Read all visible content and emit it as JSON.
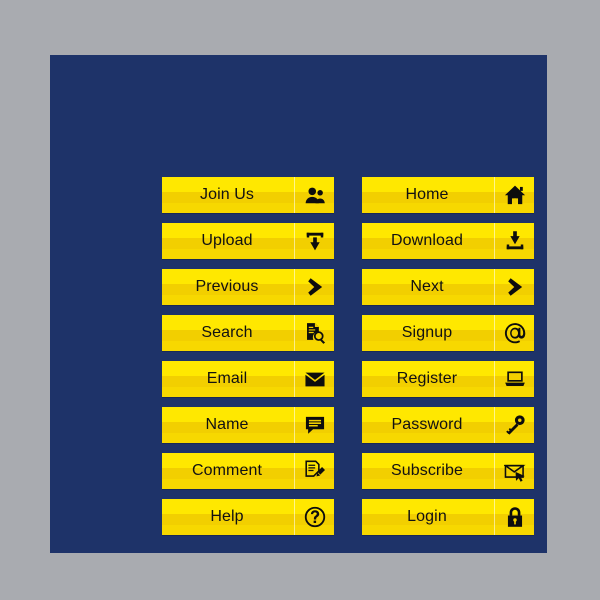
{
  "canvas": {
    "background_color": "#a9abb0",
    "panel_color": "#1e3369"
  },
  "theme": {
    "button_yellow_top": "#ffe800",
    "button_yellow_mid": "#f2cf00",
    "button_yellow_bottom": "#f7d800",
    "label_color": "#111111",
    "icon_color": "#0d0d0d"
  },
  "buttons": {
    "left_column": [
      {
        "label": "Join Us",
        "icon": "users-icon"
      },
      {
        "label": "Upload",
        "icon": "upload-tray-icon"
      },
      {
        "label": "Previous",
        "icon": "chevron-right-icon"
      },
      {
        "label": "Search",
        "icon": "document-magnifier-icon"
      },
      {
        "label": "Email",
        "icon": "envelope-icon"
      },
      {
        "label": "Name",
        "icon": "speech-bubble-icon"
      },
      {
        "label": "Comment",
        "icon": "document-pencil-icon"
      },
      {
        "label": "Help",
        "icon": "question-mark-circle-icon"
      }
    ],
    "right_column": [
      {
        "label": "Home",
        "icon": "house-icon"
      },
      {
        "label": "Download",
        "icon": "download-tray-icon"
      },
      {
        "label": "Next",
        "icon": "chevron-right-icon"
      },
      {
        "label": "Signup",
        "icon": "at-sign-icon"
      },
      {
        "label": "Register",
        "icon": "laptop-icon"
      },
      {
        "label": "Password",
        "icon": "key-icon"
      },
      {
        "label": "Subscribe",
        "icon": "envelope-cursor-icon"
      },
      {
        "label": "Login",
        "icon": "padlock-icon"
      }
    ]
  }
}
